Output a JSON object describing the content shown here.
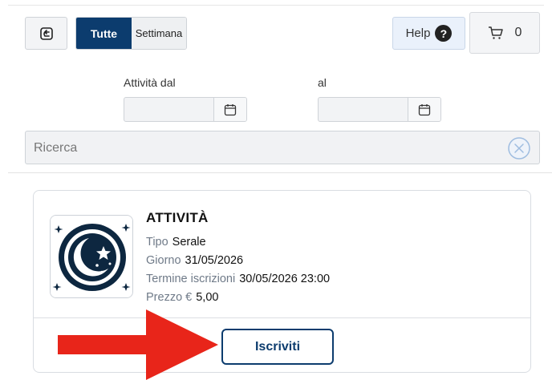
{
  "toolbar": {
    "back_icon": "exit-back-icon",
    "filter_all": "Tutte",
    "filter_week": "Settimana",
    "help_label": "Help",
    "help_icon_glyph": "?",
    "cart_icon": "cart-icon",
    "cart_count": "0"
  },
  "date_filter": {
    "from_label": "Attività dal",
    "to_label": "al",
    "from_value": "",
    "to_value": "",
    "calendar_icon": "calendar-icon"
  },
  "search": {
    "placeholder": "Ricerca",
    "clear_icon": "clear-circle-icon"
  },
  "activity": {
    "title": "ATTIVITÀ",
    "image_icon": "moon-stars-icon",
    "tipo_label": "Tipo",
    "tipo_value": "Serale",
    "giorno_label": "Giorno",
    "giorno_value": "31/05/2026",
    "termine_label": "Termine iscrizioni",
    "termine_value": "30/05/2026 23:00",
    "prezzo_label": "Prezzo €",
    "prezzo_value": "5,00",
    "subscribe_label": "Iscriviti"
  },
  "annotation": {
    "arrow_color": "#e8251a",
    "arrow_icon": "red-arrow-right"
  },
  "colors": {
    "primary": "#0c3c6e",
    "help_bg": "#eaf1fb",
    "muted_text": "#6f7a88"
  }
}
